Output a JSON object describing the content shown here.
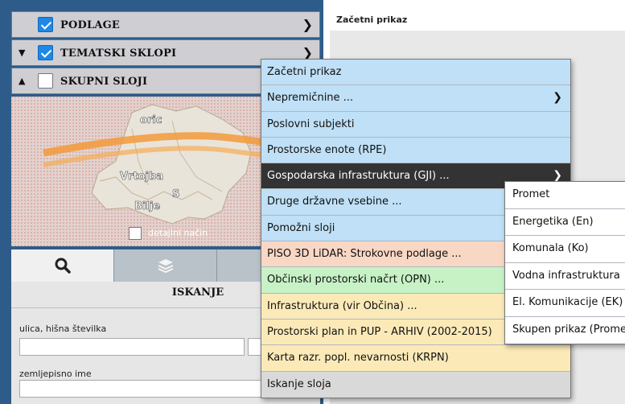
{
  "layers": {
    "podlage": {
      "label": "PODLAGE",
      "checked": true
    },
    "tematski": {
      "label": "TEMATSKI SKLOPI",
      "checked": true
    },
    "skupni": {
      "label": "SKUPNI SLOJI",
      "checked": false
    }
  },
  "map": {
    "place_labels": [
      "oric",
      "Vrtojba",
      "Bilje",
      "S"
    ],
    "detail_mode_label": "detajlni način",
    "colors": {
      "region": "#e9e4da",
      "road": "#f39a3a",
      "dots": "#d58a7a"
    }
  },
  "search": {
    "heading": "ISKANJE",
    "street_label": "ulica, hišna številka",
    "geo_label": "zemljepisno ime"
  },
  "content": {
    "title": "Začetni prikaz"
  },
  "menu": {
    "items": [
      {
        "label": "Začetni prikaz",
        "has_submenu": false
      },
      {
        "label": "Nepremičnine ...",
        "has_submenu": true
      },
      {
        "label": "Poslovni subjekti",
        "has_submenu": false
      },
      {
        "label": "Prostorske enote (RPE)",
        "has_submenu": false
      },
      {
        "label": "Gospodarska infrastruktura (GJI) ...",
        "has_submenu": true
      },
      {
        "label": "Druge državne vsebine ...",
        "has_submenu": false
      },
      {
        "label": "Pomožni sloji",
        "has_submenu": false
      },
      {
        "label": "PISO 3D LiDAR: Strokovne podlage ...",
        "has_submenu": false
      },
      {
        "label": "Občinski prostorski načrt (OPN) ...",
        "has_submenu": false
      },
      {
        "label": "Infrastruktura (vir Občina) ...",
        "has_submenu": false
      },
      {
        "label": "Prostorski plan in PUP - ARHIV (2002-2015)",
        "has_submenu": false
      },
      {
        "label": "Karta razr. popl. nevarnosti (KRPN)",
        "has_submenu": false
      },
      {
        "label": "Iskanje sloja",
        "has_submenu": false
      }
    ],
    "submenu": [
      "Promet",
      "Energetika (En)",
      "Komunala (Ko)",
      "Vodna infrastruktura",
      "El. Komunikacije (EK)",
      "Skupen prikaz (Promet)"
    ]
  },
  "colors": {
    "panel_blue": "#2e5c8a",
    "menu_blue": "#bfe0f6",
    "menu_active": "#333333",
    "menu_salmon": "#f9d7c5",
    "menu_green": "#c7f2c6",
    "menu_yellow": "#fbeab8"
  }
}
